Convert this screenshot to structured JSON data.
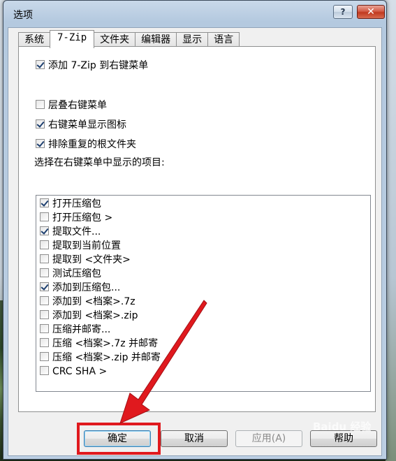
{
  "window": {
    "title": "选项",
    "help_glyph": "?",
    "close_glyph": "✕"
  },
  "tabs": [
    "系统",
    "7-Zip",
    "文件夹",
    "编辑器",
    "显示",
    "语言"
  ],
  "active_tab": "7-Zip",
  "options": {
    "add_to_context_menu": {
      "label": "添加 7-Zip 到右键菜单",
      "checked": true
    },
    "cascaded_menu": {
      "label": "层叠右键菜单",
      "checked": false
    },
    "menu_icons": {
      "label": "右键菜单显示图标",
      "checked": true
    },
    "eliminate_root_folder": {
      "label": "排除重复的根文件夹",
      "checked": true
    }
  },
  "list_heading": "选择在右键菜单中显示的项目:",
  "menu_items": [
    {
      "label": "打开压缩包",
      "checked": true
    },
    {
      "label": "打开压缩包 >",
      "checked": false
    },
    {
      "label": "提取文件...",
      "checked": true
    },
    {
      "label": "提取到当前位置",
      "checked": false
    },
    {
      "label": "提取到 <文件夹>",
      "checked": false
    },
    {
      "label": "测试压缩包",
      "checked": false
    },
    {
      "label": "添加到压缩包...",
      "checked": true
    },
    {
      "label": "添加到 <档案>.7z",
      "checked": false
    },
    {
      "label": "添加到 <档案>.zip",
      "checked": false
    },
    {
      "label": "压缩并邮寄...",
      "checked": false
    },
    {
      "label": "压缩 <档案>.7z 并邮寄",
      "checked": false
    },
    {
      "label": "压缩 <档案>.zip 并邮寄",
      "checked": false
    },
    {
      "label": "CRC SHA >",
      "checked": false
    }
  ],
  "buttons": {
    "ok": "确定",
    "cancel": "取消",
    "apply": "应用(A)",
    "help": "帮助"
  },
  "watermark": "Baidu 经验",
  "colors": {
    "annotation_red": "#e0191e",
    "close_button": "#c0391f",
    "title_bar": "#b4c9df"
  }
}
